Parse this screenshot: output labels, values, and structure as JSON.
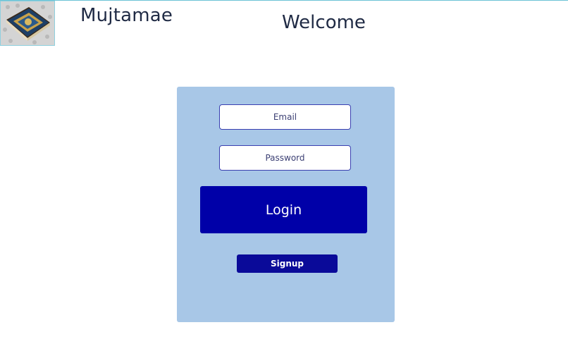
{
  "header": {
    "app_title": "Mujtamae",
    "page_heading": "Welcome",
    "logo_icon": "book-logo-icon"
  },
  "login_form": {
    "email_placeholder": "Email",
    "email_value": "",
    "password_placeholder": "Password",
    "password_value": "",
    "login_label": "Login",
    "signup_label": "Signup"
  },
  "colors": {
    "panel_background": "#a8c7e7",
    "primary_button": "#0000a8",
    "signup_button": "#0a0a99",
    "heading_text": "#1f2a44"
  }
}
